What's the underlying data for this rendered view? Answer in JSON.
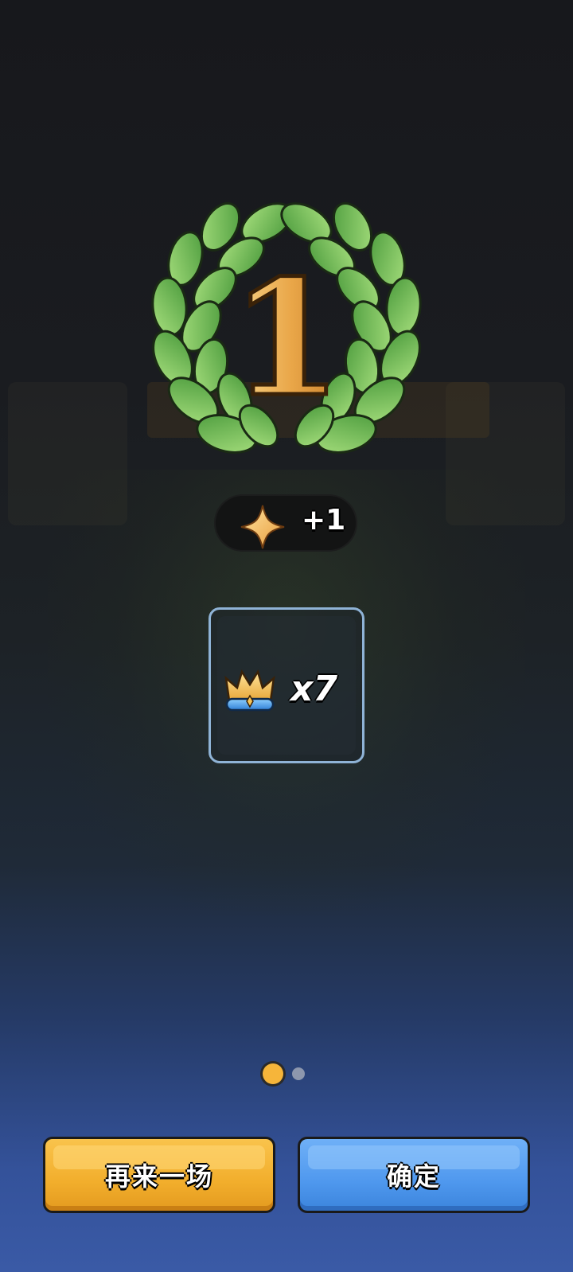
{
  "result": {
    "rank_text": "1"
  },
  "star_reward": {
    "icon": "star-icon",
    "amount_label": "+1"
  },
  "reward_item": {
    "icon": "crown-icon",
    "quantity_label": "x7"
  },
  "pager": {
    "pages": 2,
    "current": 1
  },
  "buttons": {
    "play_again_label": "再来一场",
    "confirm_label": "确定"
  },
  "colors": {
    "play_again_button": "#f2ae2c",
    "confirm_button": "#4f98ee",
    "active_dot": "#f6b53a",
    "card_border": "#8fb3d6"
  }
}
